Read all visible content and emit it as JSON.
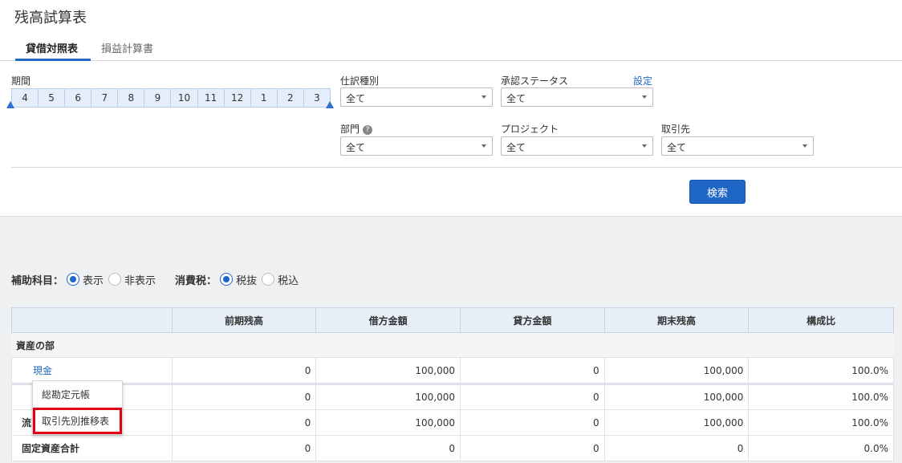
{
  "page": {
    "title": "残高試算表"
  },
  "tabs": [
    {
      "label": "貸借対照表",
      "active": true
    },
    {
      "label": "損益計算書",
      "active": false
    }
  ],
  "filters": {
    "period_label": "期間",
    "months": [
      "4",
      "5",
      "6",
      "7",
      "8",
      "9",
      "10",
      "11",
      "12",
      "1",
      "2",
      "3"
    ],
    "journal_type": {
      "label": "仕訳種別",
      "value": "全て"
    },
    "approval_status": {
      "label": "承認ステータス",
      "value": "全て",
      "settings_link": "設定"
    },
    "department": {
      "label": "部門",
      "value": "全て",
      "help": "?"
    },
    "project": {
      "label": "プロジェクト",
      "value": "全て"
    },
    "partner": {
      "label": "取引先",
      "value": "全て"
    },
    "search_button": "検索"
  },
  "options": {
    "sub_account_label": "補助科目：",
    "sub_account_show": "表示",
    "sub_account_hide": "非表示",
    "sub_account_selected": "表示",
    "tax_label": "消費税：",
    "tax_excl": "税抜",
    "tax_incl": "税込",
    "tax_selected": "税抜"
  },
  "table": {
    "headers": [
      "",
      "前期残高",
      "借方金額",
      "貸方金額",
      "期末残高",
      "構成比"
    ],
    "section": "資産の部",
    "rows": [
      {
        "name": "現金",
        "type": "link",
        "values": [
          "0",
          "100,000",
          "0",
          "100,000",
          "100.0%"
        ]
      },
      {
        "name": "",
        "type": "sub",
        "values": [
          "0",
          "100,000",
          "0",
          "100,000",
          "100.0%"
        ]
      },
      {
        "name": "流",
        "type": "total",
        "values": [
          "0",
          "100,000",
          "0",
          "100,000",
          "100.0%"
        ]
      },
      {
        "name": "固定資産合計",
        "type": "total",
        "values": [
          "0",
          "0",
          "0",
          "0",
          "0.0%"
        ]
      }
    ]
  },
  "context_menu": {
    "items": [
      "総勘定元帳",
      "取引先別推移表"
    ],
    "highlighted": "取引先別推移表"
  },
  "colors": {
    "accent": "#1e67c6",
    "highlight": "#e3000f"
  }
}
